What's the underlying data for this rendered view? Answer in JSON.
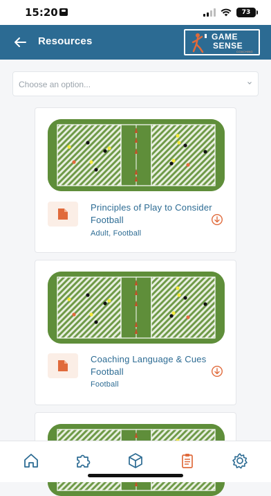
{
  "status_bar": {
    "time": "15:20",
    "battery": "73"
  },
  "header": {
    "title": "Resources"
  },
  "logo": {
    "line1": "GAME",
    "line2": "SENSE",
    "line3": "COACHING"
  },
  "filter": {
    "placeholder": "Choose an option..."
  },
  "resources": [
    {
      "title": "Principles of Play to Consider Football",
      "tags": "Adult, Football"
    },
    {
      "title": "Coaching Language & Cues Football",
      "tags": "Football"
    }
  ],
  "tabs": [
    "home-icon",
    "puzzle-icon",
    "cube-icon",
    "clipboard-icon",
    "gear-icon"
  ],
  "colors": {
    "header": "#2c6b93",
    "accent": "#e06a3b",
    "pitch": "#5f8e3a"
  }
}
